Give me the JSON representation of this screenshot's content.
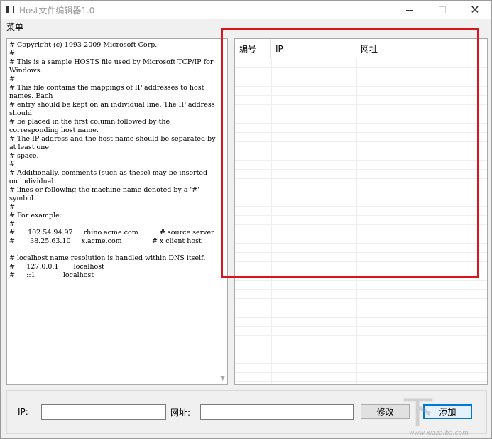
{
  "window": {
    "title": "Host文件编辑器1.0",
    "close_glyph": "✕"
  },
  "menu": {
    "label": "菜单"
  },
  "hosts": {
    "text": "# Copyright (c) 1993-2009 Microsoft Corp.\n#\n# This is a sample HOSTS file used by Microsoft TCP/IP for Windows.\n#\n# This file contains the mappings of IP addresses to host names. Each\n# entry should be kept on an individual line. The IP address should\n# be placed in the first column followed by the corresponding host name.\n# The IP address and the host name should be separated by at least one\n# space.\n#\n# Additionally, comments (such as these) may be inserted on individual\n# lines or following the machine name denoted by a '#' symbol.\n#\n# For example:\n#\n#      102.54.94.97     rhino.acme.com          # source server\n#       38.25.63.10     x.acme.com              # x client host\n\n# localhost name resolution is handled within DNS itself.\n#\t127.0.0.1       localhost\n#\t::1             localhost"
  },
  "table": {
    "headers": [
      "编号",
      "IP",
      "网址",
      ""
    ]
  },
  "form": {
    "ip_label": "IP:",
    "url_label": "网址:",
    "ip_value": "",
    "url_value": "",
    "edit_label": "修改",
    "add_label": "添加"
  },
  "colors": {
    "highlight": "#d8171c",
    "focus": "#0078d7"
  },
  "watermark": {
    "logo": "下",
    "site": "www.xiazaiba.com"
  },
  "icons": {
    "app": "app-window-icon",
    "minimize": "minimize-icon",
    "maximize": "maximize-icon",
    "close": "close-icon",
    "scroll_down": "chevron-down-icon"
  }
}
